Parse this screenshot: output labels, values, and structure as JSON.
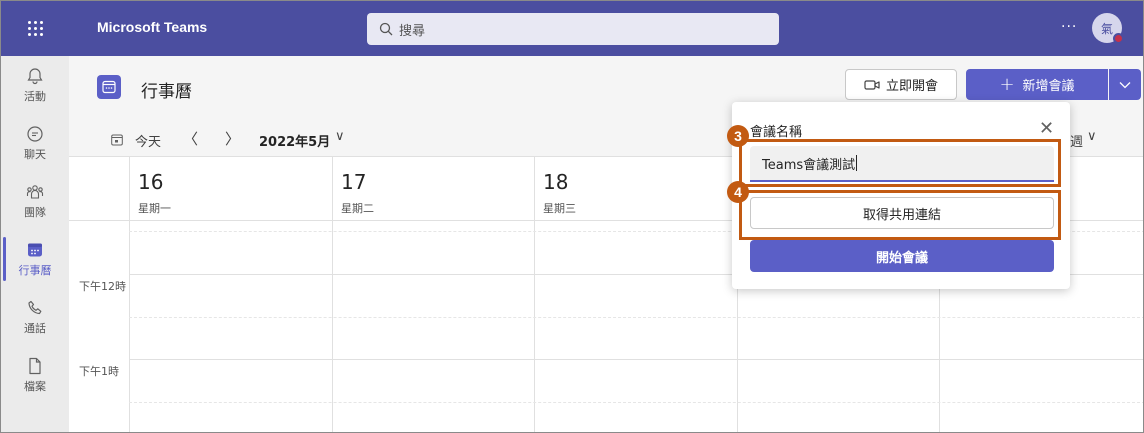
{
  "topbar": {
    "app_title": "Microsoft Teams",
    "search_placeholder": "搜尋",
    "more_label": "···",
    "avatar_initial": "氣",
    "color": "#4b4ea0"
  },
  "rail": {
    "items": [
      {
        "label": "活動",
        "icon": "bell-icon"
      },
      {
        "label": "聊天",
        "icon": "chat-icon"
      },
      {
        "label": "團隊",
        "icon": "teams-icon"
      },
      {
        "label": "行事曆",
        "icon": "calendar-icon",
        "active": true
      },
      {
        "label": "通話",
        "icon": "phone-icon"
      },
      {
        "label": "檔案",
        "icon": "file-icon"
      }
    ]
  },
  "calendar": {
    "title": "行事曆",
    "meet_now_label": "立即開會",
    "new_meeting_label": "新增會議",
    "today_label": "今天",
    "month_label": "2022年5月",
    "view_label": "週",
    "days": [
      {
        "num": "16",
        "name": "星期一"
      },
      {
        "num": "17",
        "name": "星期二"
      },
      {
        "num": "18",
        "name": "星期三"
      },
      {
        "num": "",
        "name": ""
      },
      {
        "num": "",
        "name": ""
      }
    ],
    "times": [
      "下午12時",
      "下午1時"
    ]
  },
  "popup": {
    "label": "會議名稱",
    "close_glyph": "✕",
    "input_value": "Teams會議測試",
    "link_button": "取得共用連結",
    "start_button": "開始會議"
  },
  "annotations": [
    {
      "num": "3"
    },
    {
      "num": "4"
    }
  ],
  "colors": {
    "accent": "#5b5fc7",
    "highlight": "#c25a12"
  }
}
